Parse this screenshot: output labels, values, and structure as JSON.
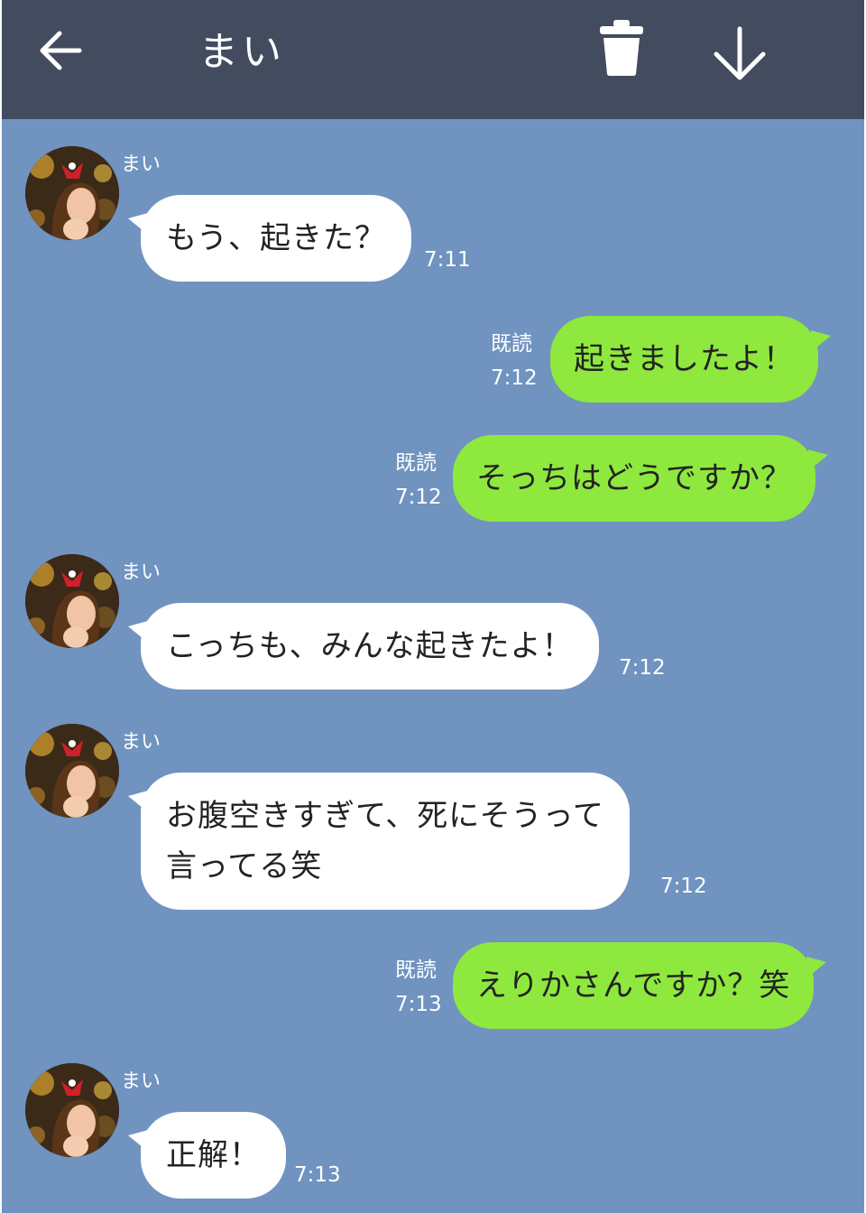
{
  "header": {
    "title": "まい",
    "back_icon": "arrow-left-icon",
    "delete_icon": "trash-icon",
    "download_icon": "arrow-down-icon"
  },
  "colors": {
    "header_bg": "#434b5f",
    "chat_bg": "#7093c0",
    "incoming_bubble": "#ffffff",
    "outgoing_bubble": "#8ee83e"
  },
  "messages": [
    {
      "direction": "in",
      "sender": "まい",
      "lines": [
        "もう、起きた？"
      ],
      "time": "7:11"
    },
    {
      "direction": "out",
      "lines": [
        "起きましたよ！"
      ],
      "read_label": "既読",
      "time": "7:12"
    },
    {
      "direction": "out",
      "lines": [
        "そっちはどうですか？"
      ],
      "read_label": "既読",
      "time": "7:12"
    },
    {
      "direction": "in",
      "sender": "まい",
      "lines": [
        "こっちも、みんな起きたよ！"
      ],
      "time": "7:12"
    },
    {
      "direction": "in",
      "sender": "まい",
      "lines": [
        "お腹空きすぎて、死にそうって",
        "言ってる笑"
      ],
      "time": "7:12"
    },
    {
      "direction": "out",
      "lines": [
        "えりかさんですか？笑"
      ],
      "read_label": "既読",
      "time": "7:13"
    },
    {
      "direction": "in",
      "sender": "まい",
      "lines": [
        "正解！"
      ],
      "time": "7:13"
    }
  ]
}
